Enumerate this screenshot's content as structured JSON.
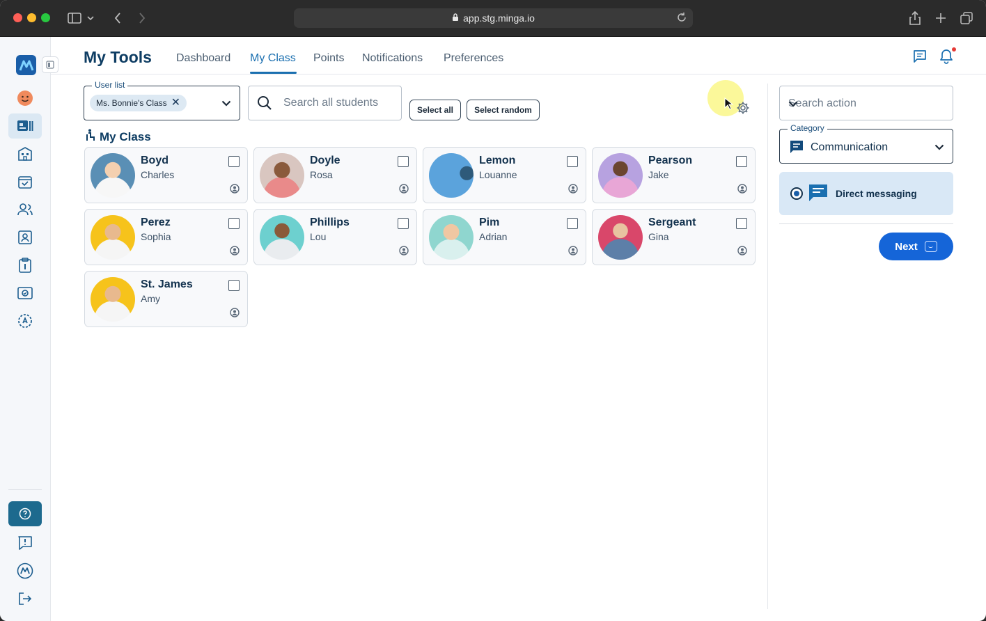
{
  "browser": {
    "url": "app.stg.minga.io"
  },
  "header": {
    "title": "My Tools",
    "tabs": [
      {
        "label": "Dashboard"
      },
      {
        "label": "My Class"
      },
      {
        "label": "Points"
      },
      {
        "label": "Notifications"
      },
      {
        "label": "Preferences"
      }
    ],
    "active_tab": "My Class"
  },
  "toolbar": {
    "user_list_label": "User list",
    "user_list_chip": "Ms. Bonnie's Class",
    "search_placeholder": "Search all students",
    "select_all_label": "Select all",
    "select_random_label": "Select random"
  },
  "section": {
    "title": "My Class"
  },
  "students": [
    {
      "last": "Boyd",
      "first": "Charles"
    },
    {
      "last": "Doyle",
      "first": "Rosa"
    },
    {
      "last": "Lemon",
      "first": "Louanne"
    },
    {
      "last": "Pearson",
      "first": "Jake"
    },
    {
      "last": "Perez",
      "first": "Sophia"
    },
    {
      "last": "Phillips",
      "first": "Lou"
    },
    {
      "last": "Pim",
      "first": "Adrian"
    },
    {
      "last": "Sergeant",
      "first": "Gina"
    },
    {
      "last": "St. James",
      "first": "Amy"
    }
  ],
  "panel": {
    "search_action_placeholder": "Search action",
    "category_label": "Category",
    "category_value": "Communication",
    "action_option": "Direct messaging",
    "next_label": "Next"
  },
  "colors": {
    "primary": "#1565d8",
    "brand_dark": "#0e3d63",
    "selected_bg": "#d9e8f6"
  }
}
